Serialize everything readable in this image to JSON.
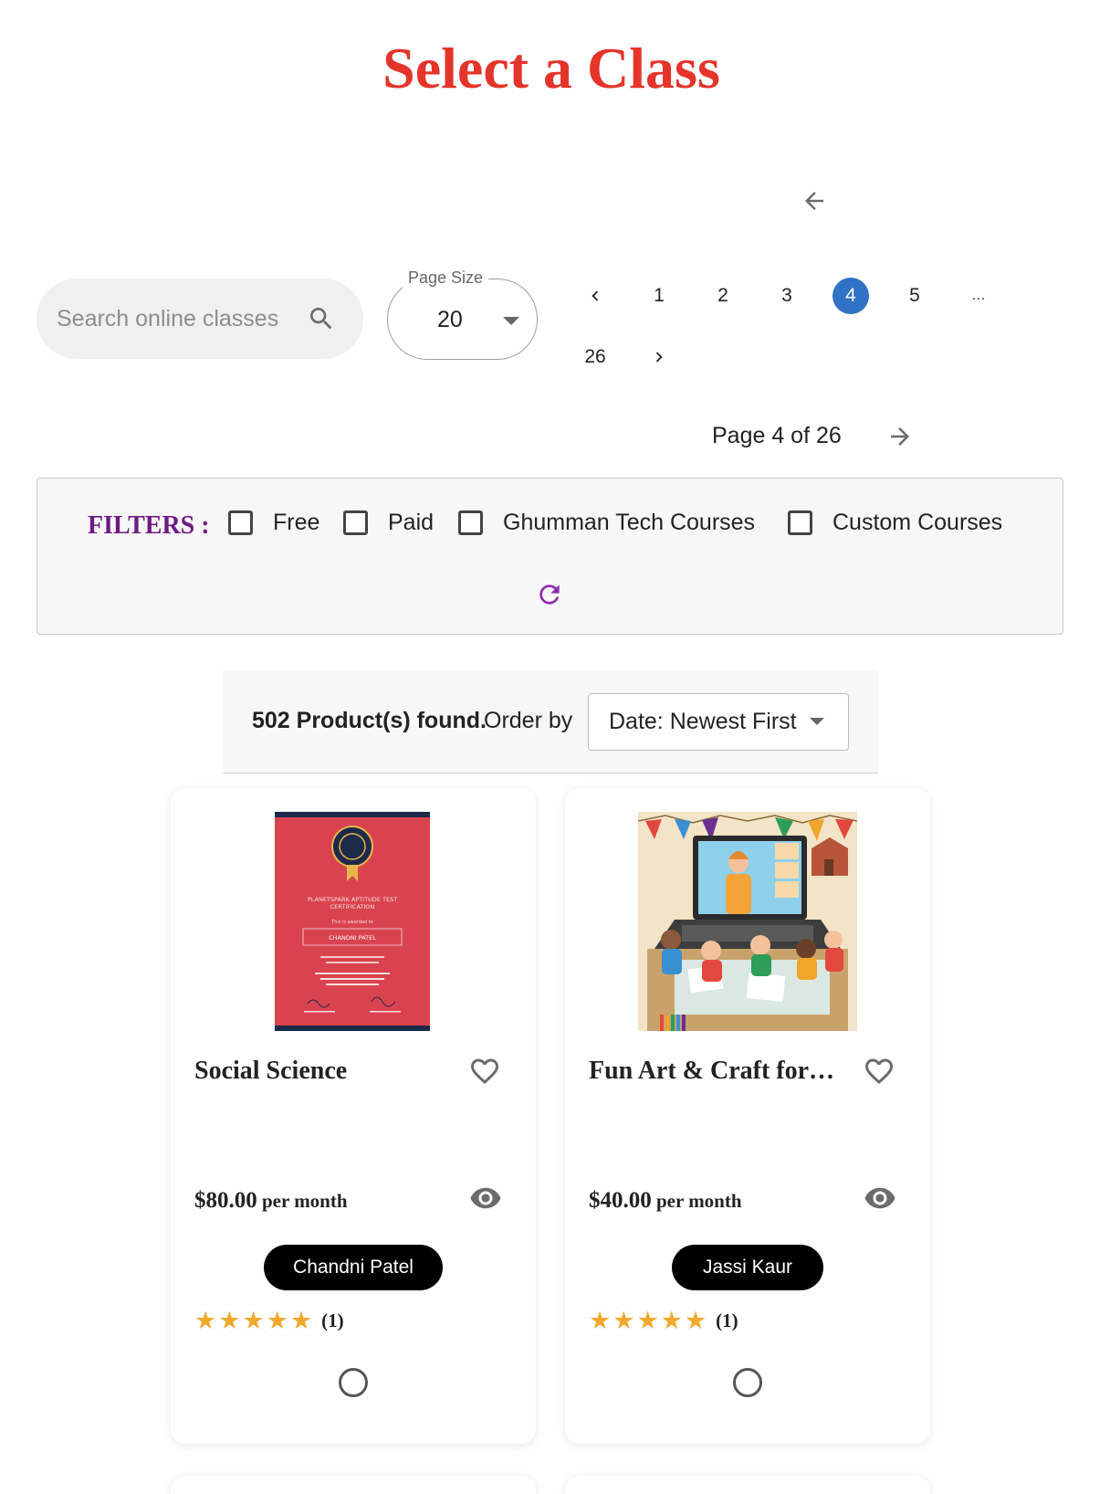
{
  "page": {
    "title": "Select a Class"
  },
  "search": {
    "placeholder": "Search online classes"
  },
  "page_size": {
    "legend": "Page Size",
    "value": "20"
  },
  "pagination": {
    "items": [
      "1",
      "2",
      "3",
      "4",
      "5",
      "…",
      "26"
    ],
    "current": "4",
    "summary": "Page 4 of 26"
  },
  "filters": {
    "label": "FILTERS :",
    "options": [
      "Free",
      "Paid",
      "Ghumman Tech Courses",
      "Custom Courses"
    ]
  },
  "results": {
    "count": "502 Product(s) found.",
    "order_label": "Order by",
    "order_value": "Date: Newest First"
  },
  "cards": [
    {
      "title": "Social Science",
      "price": "$80.00",
      "period": " per month",
      "teacher": "Chandni Patel",
      "rating_count": "(1)",
      "image": {
        "org": "PLANETSPARK",
        "heading1": "PLANETSPARK APTITUDE TEST",
        "heading2": "CERTIFICATION",
        "presented": "This is awarded to",
        "name": "CHANDNI PATEL"
      }
    },
    {
      "title": "Fun Art & Craft for…",
      "price": "$40.00",
      "period": " per month",
      "teacher": "Jassi Kaur",
      "rating_count": "(1)"
    }
  ],
  "colors": {
    "title": "#e5342a",
    "filters_label": "#6e1a82",
    "active_page": "#2f72c6",
    "refresh": "#8e2bb0",
    "star": "#f0a92e"
  }
}
